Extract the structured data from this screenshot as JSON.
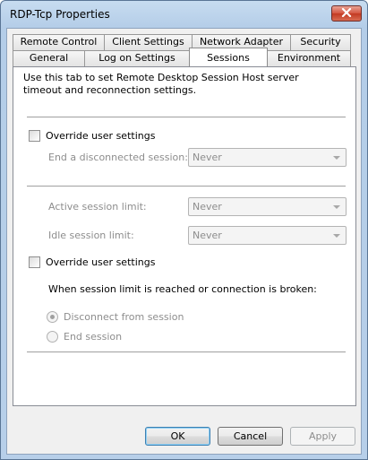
{
  "window": {
    "title": "RDP-Tcp Properties",
    "close_icon": "close-x-icon"
  },
  "tabs": {
    "back_row": [
      "Remote Control",
      "Client Settings",
      "Network Adapter",
      "Security"
    ],
    "front_row": [
      "General",
      "Log on Settings",
      "Sessions",
      "Environment"
    ],
    "active": "Sessions"
  },
  "sessions": {
    "description": "Use this tab to set Remote Desktop Session Host server timeout and reconnection settings.",
    "override_1_label": "Override user settings",
    "end_disconnected_label": "End a disconnected session:",
    "end_disconnected_value": "Never",
    "active_limit_label": "Active session limit:",
    "active_limit_value": "Never",
    "idle_limit_label": "Idle session limit:",
    "idle_limit_value": "Never",
    "override_2_label": "Override user settings",
    "limit_reached_label": "When session limit is reached or connection is broken:",
    "radio_disconnect_label": "Disconnect from session",
    "radio_end_label": "End session"
  },
  "buttons": {
    "ok": "OK",
    "cancel": "Cancel",
    "apply": "Apply"
  }
}
